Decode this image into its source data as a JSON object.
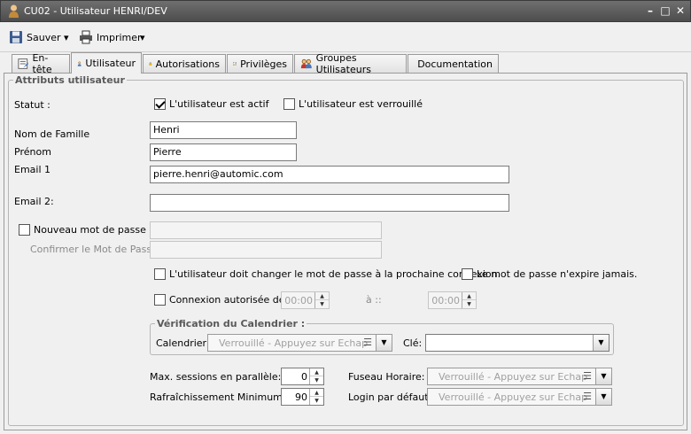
{
  "window": {
    "title": "CU02 - Utilisateur HENRI/DEV",
    "min": "–",
    "max": "□",
    "close": "✕"
  },
  "toolbar": {
    "save_label": "Sauver",
    "print_label": "Imprimer",
    "caret": "▾"
  },
  "tabs": [
    {
      "label": "En-tête"
    },
    {
      "label": "Utilisateur"
    },
    {
      "label": "Autorisations"
    },
    {
      "label": "Privilèges"
    },
    {
      "label": "Groupes Utilisateurs"
    },
    {
      "label": "Documentation"
    }
  ],
  "form": {
    "group_title": "Attributs utilisateur",
    "statut_label": "Statut :",
    "active_label": "L'utilisateur est actif",
    "active_checked": true,
    "locked_label": "L'utilisateur est verrouillé",
    "locked_checked": false,
    "lastname_label": "Nom de Famille",
    "lastname_value": "Henri",
    "firstname_label": "Prénom",
    "firstname_value": "Pierre",
    "email1_label": "Email 1",
    "email1_value": "pierre.henri@automic.com",
    "email2_label": "Email 2:",
    "email2_value": "",
    "newpw_label": "Nouveau mot de passe :",
    "confirmpw_label": "Confirmer le Mot de Passe:",
    "mustchange_label": "L'utilisateur doit changer le mot de passe à la prochaine connexion.",
    "noexpire_label": "Le mot de passe n'expire jamais.",
    "login_allowed_label": "Connexion autorisée de :",
    "time_from": "00:00",
    "to_label": "à ::",
    "time_to": "00:00",
    "calendar_group_title": "Vérification du Calendrier :",
    "calendar_label": "Calendrier:",
    "calendar_value": "Verrouillé - Appuyez sur Echap",
    "key_label": "Clé:",
    "key_value": "",
    "max_sessions_label": "Max. sessions en parallèle:",
    "max_sessions_value": "0",
    "refresh_label": "Rafraîchissement Minimum:",
    "refresh_value": "90",
    "timezone_label": "Fuseau Horaire:",
    "timezone_value": "Verrouillé - Appuyez sur Echap",
    "default_login_label": "Login par défaut:",
    "default_login_value": "Verrouillé - Appuyez sur Echap"
  },
  "icons": {
    "list": "☰",
    "dropdown": "▼",
    "up": "▲",
    "down": "▼"
  },
  "colors": {
    "titlebar": "#555555",
    "panel": "#f0f0f0"
  }
}
